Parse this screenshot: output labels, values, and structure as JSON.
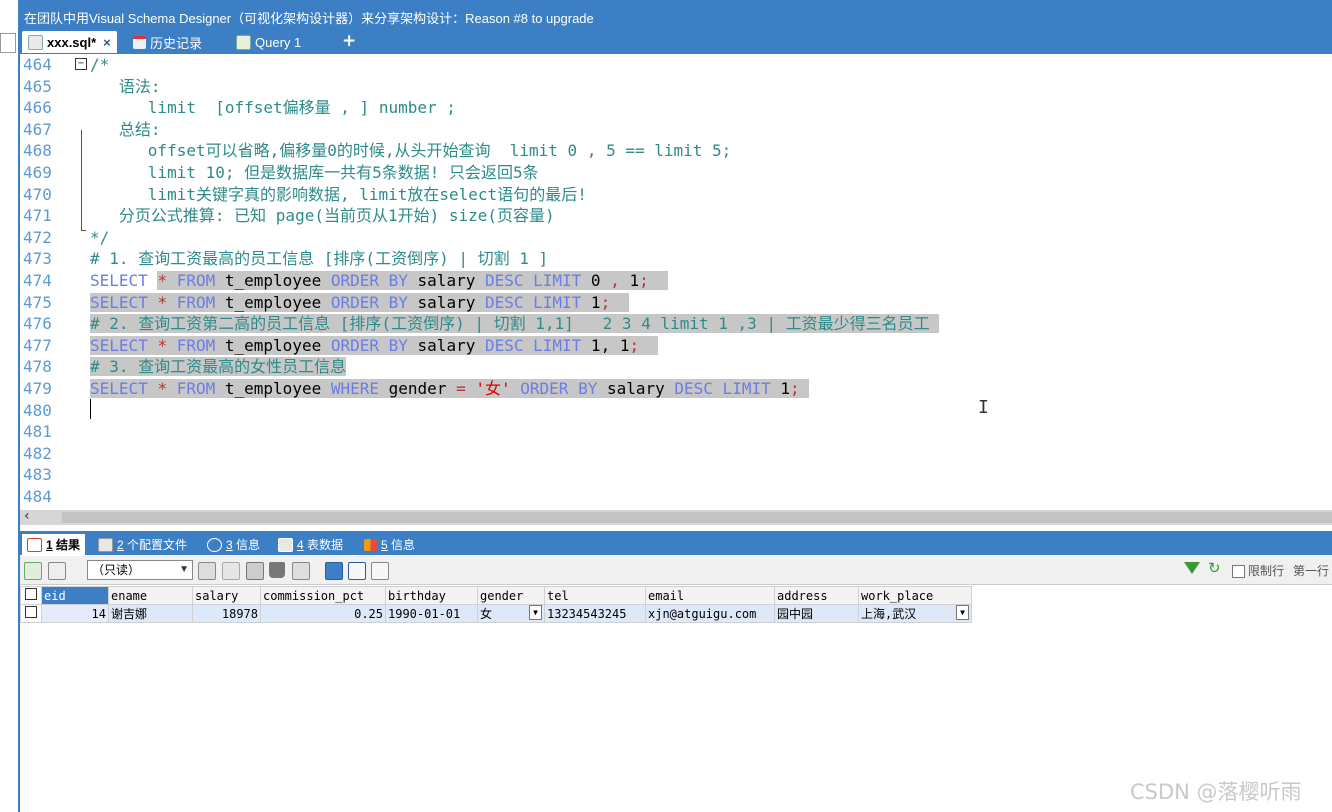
{
  "window": {
    "title": "在团队中用Visual Schema Designer（可视化架构设计器）来分享架构设计：Reason #8 to upgrade"
  },
  "tabs": [
    {
      "label": "xxx.sql*",
      "close": "×"
    },
    {
      "label": "历史记录"
    },
    {
      "label": "Query 1"
    }
  ],
  "new_tab": "+",
  "editor": {
    "lines": [
      {
        "n": "464",
        "parts": [
          {
            "c": "cm",
            "t": "/*"
          }
        ]
      },
      {
        "n": "465",
        "parts": [
          {
            "c": "cm",
            "t": "   语法:"
          }
        ]
      },
      {
        "n": "466",
        "parts": [
          {
            "c": "cm",
            "t": "      limit  [offset偏移量 , ] number ;"
          }
        ]
      },
      {
        "n": "467",
        "parts": [
          {
            "c": "cm",
            "t": "   总结:"
          }
        ]
      },
      {
        "n": "468",
        "parts": [
          {
            "c": "cm",
            "t": "      offset可以省略,偏移量0的时候,从头开始查询  limit 0 , 5 == limit 5;"
          }
        ]
      },
      {
        "n": "469",
        "parts": [
          {
            "c": "cm",
            "t": "      limit 10; 但是数据库一共有5条数据! 只会返回5条"
          }
        ]
      },
      {
        "n": "470",
        "parts": [
          {
            "c": "cm",
            "t": "      limit关键字真的影响数据, limit放在select语句的最后!"
          }
        ]
      },
      {
        "n": "471",
        "parts": [
          {
            "c": "cm",
            "t": "   分页公式推算: 已知 page(当前页从1开始) size(页容量)"
          }
        ]
      },
      {
        "n": "472",
        "parts": [
          {
            "c": "cm",
            "t": "*/"
          }
        ]
      },
      {
        "n": "473",
        "parts": [
          {
            "c": "cm",
            "t": "# 1. 查询工资最高的员工信息 [排序(工资倒序) | 切割 1 ]"
          }
        ]
      },
      {
        "n": "474",
        "parts": [
          {
            "c": "kw",
            "t": "SELECT "
          },
          {
            "c": "op hl",
            "t": "*"
          },
          {
            "c": "kw hl",
            "t": " FROM"
          },
          {
            "c": "tx hl",
            "t": " t_employee "
          },
          {
            "c": "kw hl",
            "t": "ORDER BY"
          },
          {
            "c": "tx hl",
            "t": " salary "
          },
          {
            "c": "kw hl",
            "t": "DESC LIMIT"
          },
          {
            "c": "tx hl",
            "t": " 0 "
          },
          {
            "c": "op hl",
            "t": ","
          },
          {
            "c": "tx hl",
            "t": " 1"
          },
          {
            "c": "op hl",
            "t": ";"
          },
          {
            "c": "hl",
            "t": "  "
          }
        ]
      },
      {
        "n": "475",
        "parts": [
          {
            "c": "kw hl",
            "t": "SELECT "
          },
          {
            "c": "op hl",
            "t": "*"
          },
          {
            "c": "kw hl",
            "t": " FROM"
          },
          {
            "c": "tx hl",
            "t": " t_employee "
          },
          {
            "c": "kw hl",
            "t": "ORDER BY"
          },
          {
            "c": "tx hl",
            "t": " salary "
          },
          {
            "c": "kw hl",
            "t": "DESC LIMIT"
          },
          {
            "c": "tx hl",
            "t": " 1"
          },
          {
            "c": "op hl",
            "t": ";"
          },
          {
            "c": "hl",
            "t": "  "
          }
        ]
      },
      {
        "n": "476",
        "parts": [
          {
            "c": "cm hl",
            "t": "# 2. 查询工资第二高的员工信息 [排序(工资倒序) | 切割 1,1]   2 3 4 limit 1 ,3 | 工资最少得三名员工 "
          }
        ]
      },
      {
        "n": "477",
        "parts": [
          {
            "c": "kw hl",
            "t": "SELECT "
          },
          {
            "c": "op hl",
            "t": "*"
          },
          {
            "c": "kw hl",
            "t": " FROM"
          },
          {
            "c": "tx hl",
            "t": " t_employee "
          },
          {
            "c": "kw hl",
            "t": "ORDER BY"
          },
          {
            "c": "tx hl",
            "t": " salary "
          },
          {
            "c": "kw hl",
            "t": "DESC LIMIT"
          },
          {
            "c": "tx hl",
            "t": " 1, 1"
          },
          {
            "c": "op hl",
            "t": ";"
          },
          {
            "c": "hl",
            "t": "  "
          }
        ]
      },
      {
        "n": "478",
        "parts": [
          {
            "c": "cm hl",
            "t": "# 3. 查询工资最高的女性员工信息"
          }
        ]
      },
      {
        "n": "479",
        "parts": [
          {
            "c": "kw hl",
            "t": "SELECT "
          },
          {
            "c": "op hl",
            "t": "*"
          },
          {
            "c": "kw hl",
            "t": " FROM"
          },
          {
            "c": "tx hl",
            "t": " t_employee "
          },
          {
            "c": "kw hl",
            "t": "WHERE"
          },
          {
            "c": "tx hl",
            "t": " gender "
          },
          {
            "c": "op hl",
            "t": "="
          },
          {
            "c": "str hl",
            "t": " '女' "
          },
          {
            "c": "kw hl",
            "t": "ORDER BY"
          },
          {
            "c": "tx hl",
            "t": " salary "
          },
          {
            "c": "kw hl",
            "t": "DESC LIMIT"
          },
          {
            "c": "tx hl",
            "t": " 1"
          },
          {
            "c": "op hl",
            "t": ";"
          },
          {
            "c": "hl",
            "t": " "
          }
        ]
      },
      {
        "n": "480",
        "parts": []
      },
      {
        "n": "481",
        "parts": []
      },
      {
        "n": "482",
        "parts": []
      },
      {
        "n": "483",
        "parts": []
      },
      {
        "n": "484",
        "parts": []
      }
    ]
  },
  "result_tabs": [
    {
      "num": "1",
      "label": " 结果"
    },
    {
      "num": "2",
      "label": " 个配置文件"
    },
    {
      "num": "3",
      "label": " 信息"
    },
    {
      "num": "4",
      "label": " 表数据"
    },
    {
      "num": "5",
      "label": " 信息"
    }
  ],
  "toolbar": {
    "readonly_select": "（只读）",
    "limit_rows_label": "限制行",
    "first_row_label": "第一行"
  },
  "result_table": {
    "columns": [
      "eid",
      "ename",
      "salary",
      "commission_pct",
      "birthday",
      "gender",
      "tel",
      "email",
      "address",
      "work_place"
    ],
    "rows": [
      [
        "14",
        "谢吉娜",
        "18978",
        "0.25",
        "1990-01-01",
        "女",
        "13234543245",
        "xjn@atguigu.com",
        "园中园",
        "上海,武汉"
      ]
    ]
  },
  "watermark": "CSDN @落樱听雨"
}
